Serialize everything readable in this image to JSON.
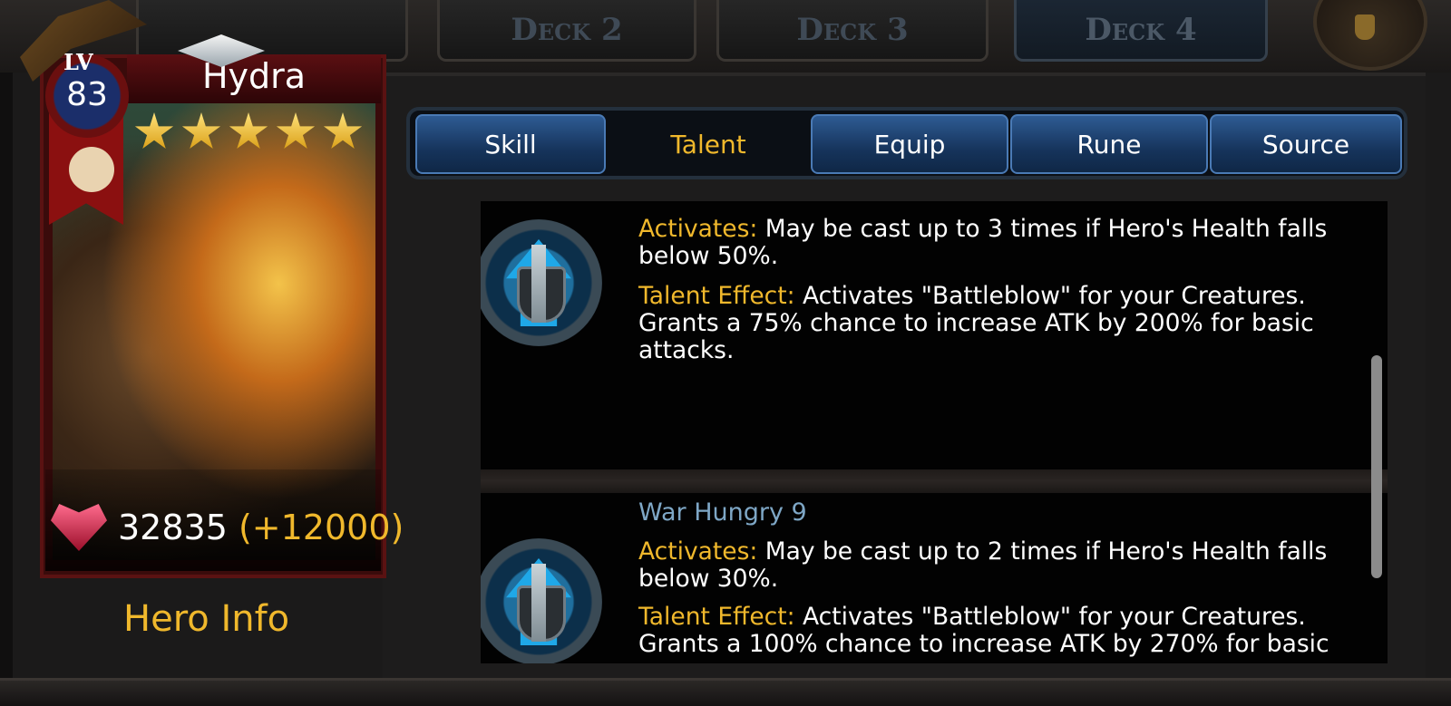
{
  "deck_tabs": [
    {
      "label": "Deck 2",
      "active": false
    },
    {
      "label": "Deck 3",
      "active": false
    },
    {
      "label": "Deck 4",
      "active": true
    }
  ],
  "hero": {
    "name": "Hydra",
    "level_label": "LV",
    "level": "83",
    "stars": 5,
    "power": "32835",
    "power_bonus": "(+12000)",
    "info_label": "Hero Info"
  },
  "tabs": [
    {
      "label": "Skill",
      "active": false
    },
    {
      "label": "Talent",
      "active": true
    },
    {
      "label": "Equip",
      "active": false
    },
    {
      "label": "Rune",
      "active": false
    },
    {
      "label": "Source",
      "active": false
    }
  ],
  "talents": [
    {
      "title": "",
      "activates_label": "Activates:",
      "activates_text": "May be cast up to 3 times if Hero's Health falls below 50%.",
      "effect_label": "Talent Effect:",
      "effect_text": "Activates \"Battleblow\" for your Creatures. Grants a 75% chance to increase ATK by 200% for basic attacks."
    },
    {
      "title": "War Hungry 9",
      "activates_label": "Activates:",
      "activates_text": "May be cast up to 2 times if Hero's Health falls below 30%.",
      "effect_label": "Talent Effect:",
      "effect_text": "Activates \"Battleblow\" for your Creatures. Grants a 100% chance to increase ATK by 270% for basic"
    }
  ],
  "colors": {
    "accent_gold": "#f0b82c",
    "title_blue": "#7ea7c6",
    "tab_blue": "#16345c"
  }
}
